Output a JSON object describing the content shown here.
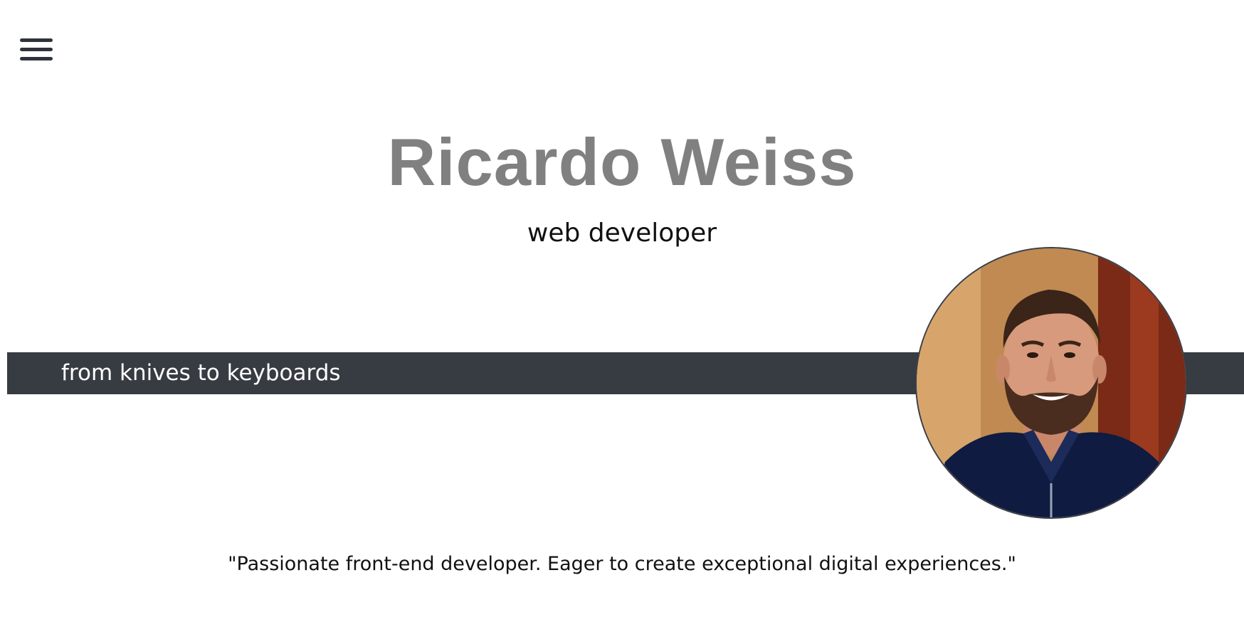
{
  "header": {
    "menu_icon": "hamburger-menu-icon"
  },
  "hero": {
    "name": "Ricardo Weiss",
    "role": "web developer",
    "tagline": "from knives to keyboards",
    "quote": "\"Passionate front-end developer. Eager to create exceptional digital experiences.\""
  },
  "colors": {
    "name_gray": "#808080",
    "band_dark": "#373b42",
    "menu_dark": "#2f333b"
  }
}
